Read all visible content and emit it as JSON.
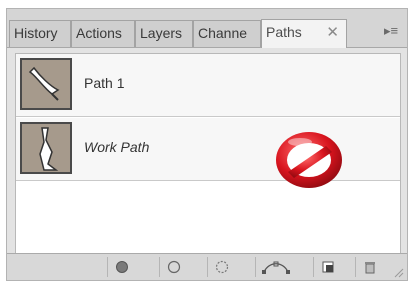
{
  "tabs": [
    {
      "label": "History",
      "active": false
    },
    {
      "label": "Actions",
      "active": false
    },
    {
      "label": "Layers",
      "active": false
    },
    {
      "label": "Channe",
      "active": false
    },
    {
      "label": "Paths",
      "active": true
    }
  ],
  "tab_close_glyph": "✕",
  "panel_menu_glyph": "▸≡",
  "paths": [
    {
      "name": "Path 1",
      "style": "normal"
    },
    {
      "name": "Work Path",
      "style": "italic"
    }
  ],
  "overlay_icon": "no-entry-icon",
  "footer_icons": [
    "fill-path-icon",
    "stroke-path-icon",
    "load-selection-icon",
    "make-work-path-icon",
    "new-path-icon",
    "delete-path-icon"
  ],
  "colors": {
    "thumbnail_bg": "#a69a8c",
    "no_sign_red": "#d8141e"
  }
}
